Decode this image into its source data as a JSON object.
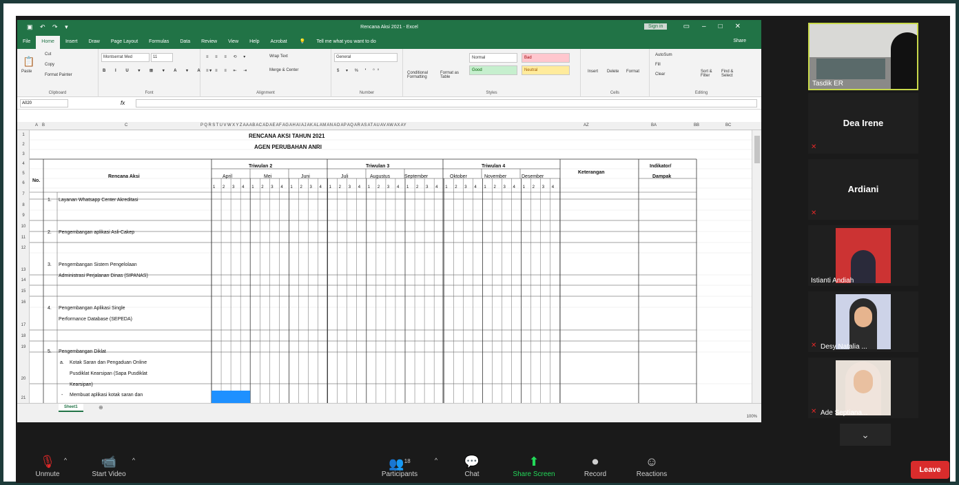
{
  "excel": {
    "title": "Rencana Aksi 2021 - Excel",
    "sign_in": "Sign in",
    "tabs": [
      "File",
      "Home",
      "Insert",
      "Draw",
      "Page Layout",
      "Formulas",
      "Data",
      "Review",
      "View",
      "Help",
      "Acrobat"
    ],
    "tell_me": "Tell me what you want to do",
    "share": "Share",
    "ribbon": {
      "clipboard": {
        "cut": "Cut",
        "copy": "Copy",
        "format_painter": "Format Painter",
        "paste": "Paste",
        "label": "Clipboard"
      },
      "font": {
        "name": "Montserrat Med",
        "size": "11",
        "label": "Font"
      },
      "alignment": {
        "wrap": "Wrap Text",
        "merge": "Merge & Center",
        "label": "Alignment"
      },
      "number": {
        "format": "General",
        "label": "Number"
      },
      "styles": {
        "cond": "Conditional Formatting",
        "table": "Format as Table",
        "normal": "Normal",
        "bad": "Bad",
        "good": "Good",
        "neutral": "Neutral",
        "label": "Styles"
      },
      "cells": {
        "insert": "Insert",
        "delete": "Delete",
        "format": "Format",
        "label": "Cells"
      },
      "editing": {
        "autosum": "AutoSum",
        "fill": "Fill",
        "clear": "Clear",
        "sort": "Sort & Filter",
        "find": "Find & Select",
        "label": "Editing"
      }
    },
    "name_box": "A020",
    "fx": "fx",
    "col_letters_left": [
      "A",
      "B",
      "C"
    ],
    "col_letters_mid": "P Q R S T U V W X Y Z AA AB AC AD AE AF AG AH AI AJ AK AL AM AN AO AP AQ AR AS AT AU AV AW AX AY",
    "col_letters_right": [
      "AZ",
      "BA",
      "BB",
      "BC"
    ],
    "row_numbers": [
      "1",
      "2",
      "3",
      "4",
      "5",
      "6",
      "7",
      "8",
      "9",
      "10",
      "11",
      "12",
      "13",
      "14",
      "15",
      "16",
      "17",
      "18",
      "19",
      "20",
      "21"
    ],
    "sheet_title1": "RENCANA AKSI TAHUN 2021",
    "sheet_title2": "AGEN PERUBAHAN ANRI",
    "headers": {
      "no": "No.",
      "rencana": "Rencana Aksi",
      "tw2": "Triwulan 2",
      "tw3": "Triwulan 3",
      "tw4": "Triwulan 4",
      "ket": "Keterangan",
      "ind1": "Indikator/",
      "ind2": "Dampak",
      "months": [
        "April",
        "Mei",
        "Juni",
        "Juli",
        "Augustus",
        "September",
        "Oktober",
        "November",
        "Desember"
      ],
      "weeks": [
        "1",
        "2",
        "3",
        "4"
      ]
    },
    "rows": [
      {
        "no": "1.",
        "text": "Layanan Whatsapp Center Akreditasi"
      },
      {
        "no": "2.",
        "text": "Pengembangan aplikasi Asli-Cakep"
      },
      {
        "no": "3.",
        "text": "Pengembangan Sistem Pengelolaan",
        "text2": "Administrasi Perjalanan Dinas (SIPANAS)"
      },
      {
        "no": "4.",
        "text": "Pengembangan Aplikasi Single",
        "text2": "Performance Database (SEPEDA)"
      },
      {
        "no": "5.",
        "text": "Pengembangan Diklat"
      },
      {
        "no": "a.",
        "text": "Kotak Saran dan Pengaduan Online",
        "text2": "Pusdiklat Kearsipan (Sapa Pusdiklat",
        "text3": "Kearsipan)"
      },
      {
        "no": "-",
        "text": "Membuat aplikasi kotak saran dan"
      }
    ],
    "sheet_tab": "Sheet1",
    "zoom": "100%"
  },
  "participants_panel": [
    {
      "name": "Tasdik ER",
      "type": "video"
    },
    {
      "name": "Dea Irene",
      "type": "name"
    },
    {
      "name": "Ardiani",
      "type": "name"
    },
    {
      "name": "Istianti Andiah",
      "type": "video"
    },
    {
      "name": "Desy Natalia ...",
      "type": "video"
    },
    {
      "name": "Ade Septiana...",
      "type": "video"
    }
  ],
  "toolbar": {
    "unmute": "Unmute",
    "start_video": "Start Video",
    "participants": "Participants",
    "participants_count": "18",
    "chat": "Chat",
    "share_screen": "Share Screen",
    "record": "Record",
    "reactions": "Reactions",
    "leave": "Leave"
  },
  "colors": {
    "excel_green": "#217346",
    "selected_fill": "#1e90ff",
    "leave_red": "#d92c2c",
    "share_green": "#23d959"
  }
}
